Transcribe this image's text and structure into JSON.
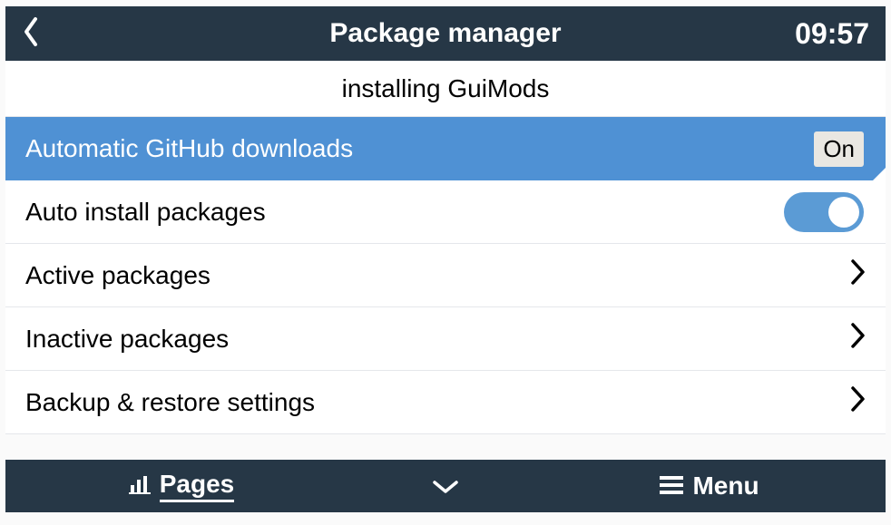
{
  "header": {
    "title": "Package manager",
    "time": "09:57"
  },
  "status_text": "installing GuiMods",
  "rows": {
    "auto_github": {
      "label": "Automatic GitHub downloads",
      "value": "On"
    },
    "auto_install": {
      "label": "Auto install packages"
    },
    "active": {
      "label": "Active packages"
    },
    "inactive": {
      "label": "Inactive packages"
    },
    "backup": {
      "label": "Backup & restore settings"
    }
  },
  "footer": {
    "pages_label": "Pages",
    "menu_label": "Menu"
  }
}
